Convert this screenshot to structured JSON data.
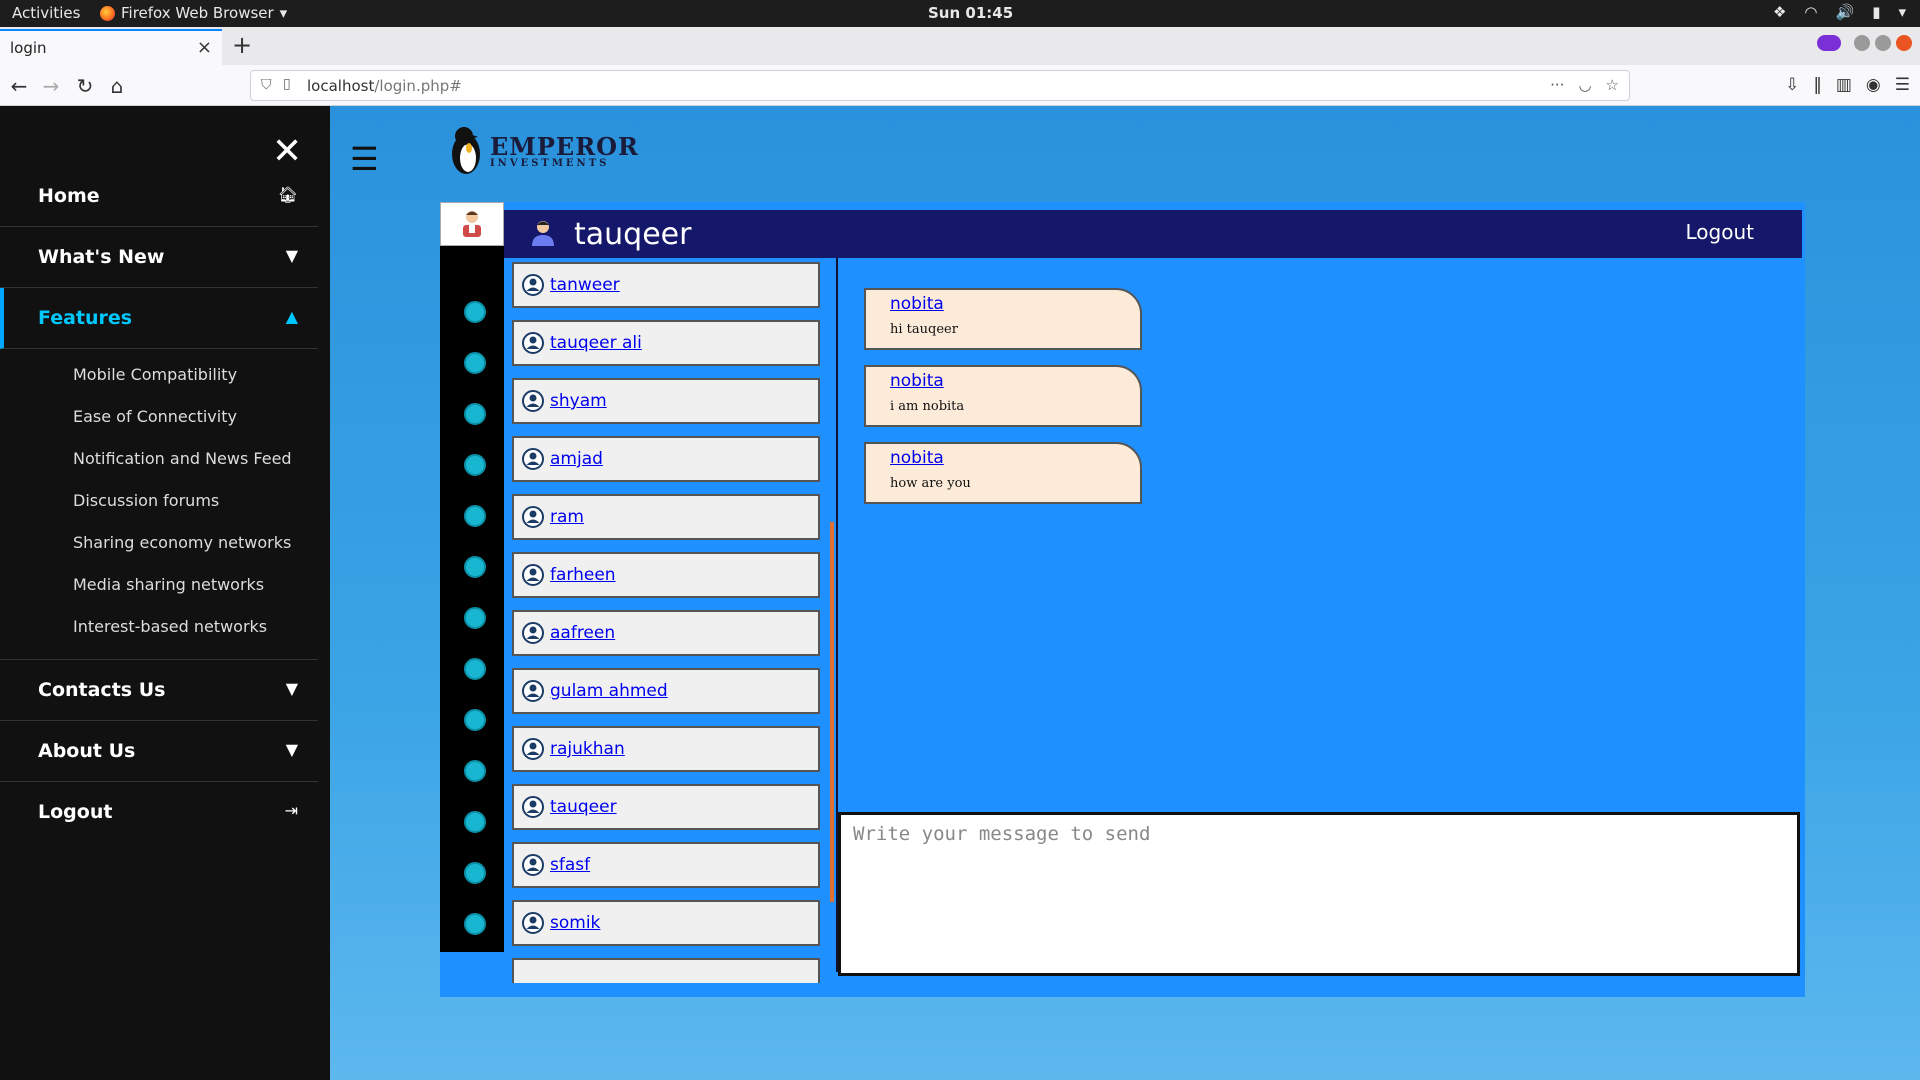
{
  "system": {
    "activities": "Activities",
    "app_name": "Firefox Web Browser",
    "clock": "Sun 01:45"
  },
  "browser": {
    "tab_title": "login",
    "url_host": "localhost",
    "url_path": "/login.php#"
  },
  "sidebar": {
    "items": [
      {
        "label": "Home",
        "icon": "home-icon"
      },
      {
        "label": "What's New",
        "icon": "caret-down-icon"
      },
      {
        "label": "Features",
        "icon": "caret-up-icon",
        "active": true
      },
      {
        "label": "Contacts Us",
        "icon": "caret-down-icon"
      },
      {
        "label": "About Us",
        "icon": "caret-down-icon"
      },
      {
        "label": "Logout",
        "icon": "sign-out-icon"
      }
    ],
    "features_submenu": [
      "Mobile Compatibility",
      "Ease of Connectivity",
      "Notification and News Feed",
      "Discussion forums",
      "Sharing economy networks",
      "Media sharing networks",
      "Interest-based networks"
    ]
  },
  "brand": {
    "name": "EMPEROR",
    "tagline": "INVESTMENTS"
  },
  "chat_header": {
    "username": "tauqeer",
    "logout_label": "Logout"
  },
  "contacts": [
    "tanweer",
    "tauqeer ali",
    "shyam",
    "amjad",
    "ram",
    "farheen",
    "aafreen",
    "gulam ahmed",
    "rajukhan",
    "tauqeer",
    "sfasf",
    "somik"
  ],
  "messages": [
    {
      "from": "nobita",
      "text": "hi tauqeer"
    },
    {
      "from": "nobita",
      "text": "i am nobita"
    },
    {
      "from": "nobita",
      "text": "how are you"
    }
  ],
  "composer": {
    "placeholder": "Write your message to send",
    "value": ""
  },
  "colors": {
    "app_background": "#1e90ff",
    "header": "#14176a",
    "message_bubble": "#fcebd8",
    "sidebar": "#111111",
    "active_menu": "#00c8ff"
  }
}
